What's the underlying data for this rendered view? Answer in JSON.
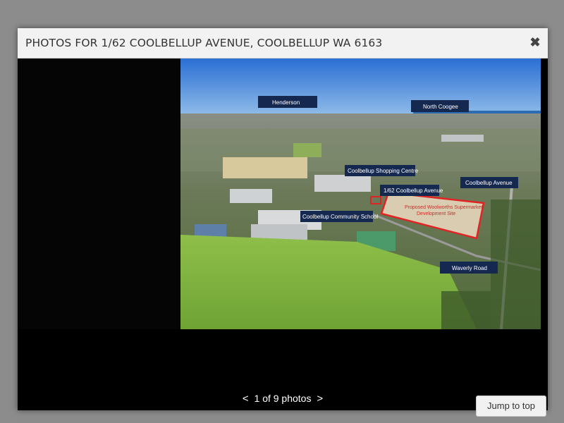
{
  "modal": {
    "title": "PHOTOS FOR 1/62 COOLBELLUP AVENUE, COOLBELLUP WA 6163",
    "close_icon": "close-icon"
  },
  "photo": {
    "labels": {
      "henderson": "Henderson",
      "north_coogee": "North Coogee",
      "shopping_centre": "Coolbellup Shopping Centre",
      "coolbellup_avenue": "Coolbellup Avenue",
      "property": "1/62 Coolbellup Avenue",
      "community_school": "Coolbellup Community School",
      "waverly_road": "Waverly Road",
      "supermarket": "Proposed Woolworths Supermarket",
      "supermarket_2": "Development Site"
    }
  },
  "pager": {
    "prev": "<",
    "text": "1 of 9 photos",
    "next": ">"
  },
  "jump_to_top": "Jump to top"
}
